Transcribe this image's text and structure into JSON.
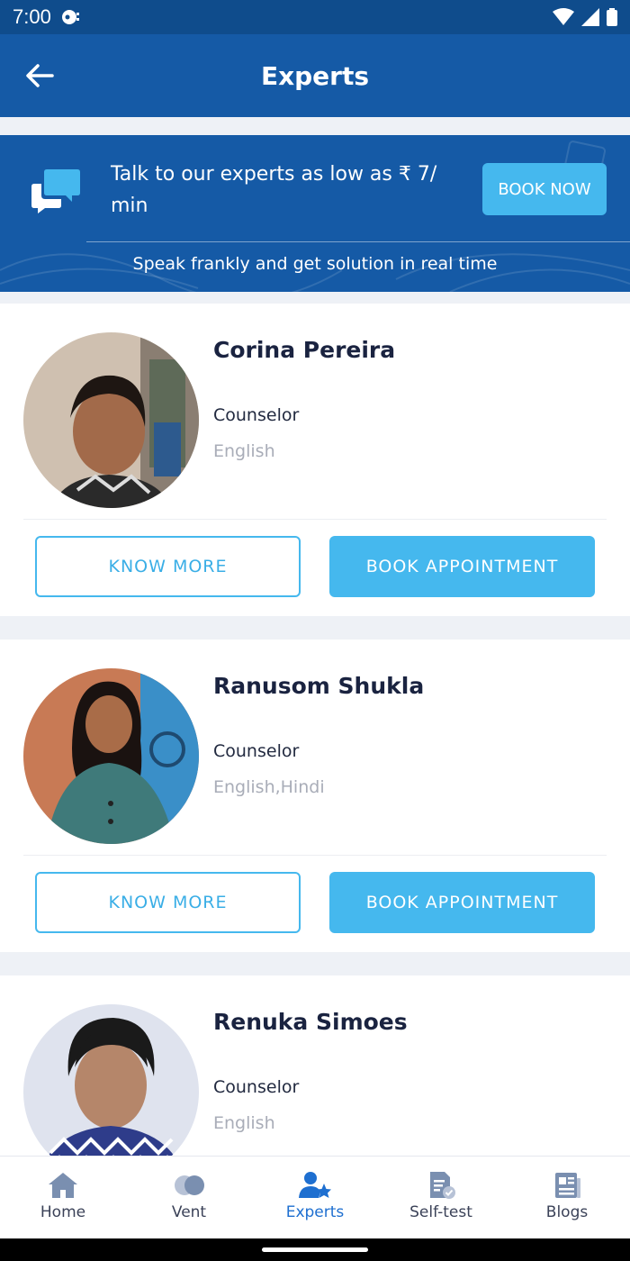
{
  "status_bar": {
    "time": "7:00"
  },
  "app_bar": {
    "title": "Experts"
  },
  "promo": {
    "headline": "Talk to our experts as low as ₹ 7/ min",
    "button_label": "BOOK NOW",
    "subtext": "Speak frankly and get solution in real time"
  },
  "experts": [
    {
      "name": "Corina Pereira",
      "role": "Counselor",
      "languages": "English",
      "know_more": "KNOW MORE",
      "book": "BOOK APPOINTMENT"
    },
    {
      "name": "Ranusom Shukla",
      "role": "Counselor",
      "languages": "English,Hindi",
      "know_more": "KNOW MORE",
      "book": "BOOK APPOINTMENT"
    },
    {
      "name": "Renuka Simoes",
      "role": "Counselor",
      "languages": "English"
    }
  ],
  "bottom_nav": [
    {
      "label": "Home",
      "icon": "home-icon"
    },
    {
      "label": "Vent",
      "icon": "vent-icon"
    },
    {
      "label": "Experts",
      "icon": "experts-icon",
      "active": true
    },
    {
      "label": "Self-test",
      "icon": "self-test-icon"
    },
    {
      "label": "Blogs",
      "icon": "blogs-icon"
    }
  ],
  "colors": {
    "primary": "#155aa6",
    "status_bar": "#0f4c8c",
    "accent": "#45b8ee",
    "active_nav": "#1e6fd0"
  }
}
